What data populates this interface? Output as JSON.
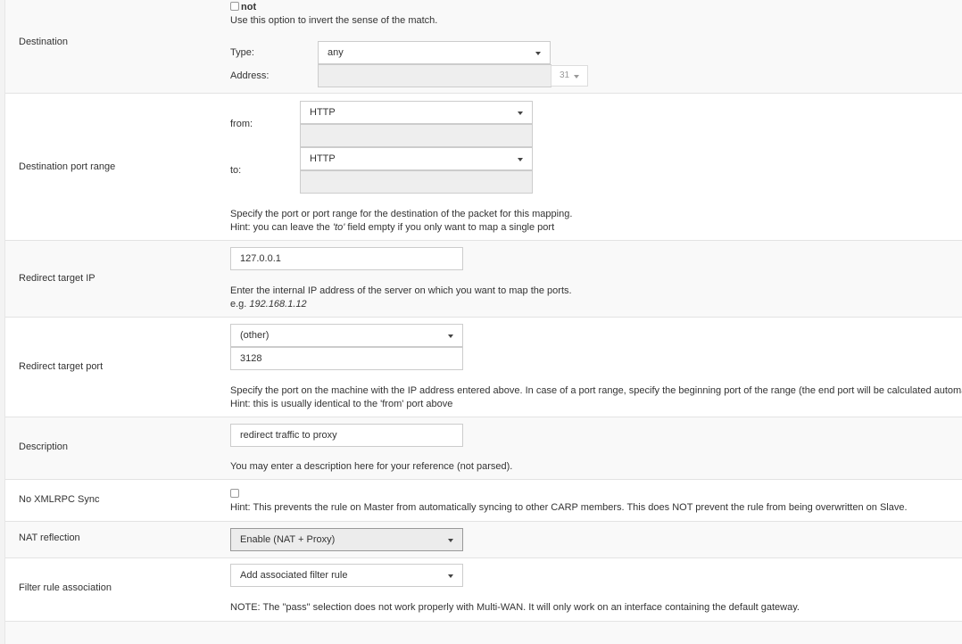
{
  "destination": {
    "label": "Destination",
    "not_label": "not",
    "invert_hint": "Use this option to invert the sense of the match.",
    "type_label": "Type:",
    "type_value": "any",
    "address_label": "Address:",
    "address_value": "",
    "mask_value": "31"
  },
  "dest_port": {
    "label": "Destination port range",
    "from_label": "from:",
    "from_value": "HTTP",
    "from_custom": "",
    "to_label": "to:",
    "to_value": "HTTP",
    "to_custom": "",
    "hint1": "Specify the port or port range for the destination of the packet for this mapping.",
    "hint2_prefix": "Hint: you can leave the ",
    "hint2_em": "'to'",
    "hint2_suffix": " field empty if you only want to map a single port"
  },
  "redirect_ip": {
    "label": "Redirect target IP",
    "value": "127.0.0.1",
    "hint": "Enter the internal IP address of the server on which you want to map the ports.",
    "example_prefix": "e.g. ",
    "example_value": "192.168.1.12"
  },
  "redirect_port": {
    "label": "Redirect target port",
    "select_value": "(other)",
    "value": "3128",
    "hint1": "Specify the port on the machine with the IP address entered above. In case of a port range, specify the beginning port of the range (the end port will be calculated automatically).",
    "hint2": "Hint: this is usually identical to the 'from' port above"
  },
  "description": {
    "label": "Description",
    "value": "redirect traffic to proxy",
    "hint": "You may enter a description here for your reference (not parsed)."
  },
  "xmlrpc": {
    "label": "No XMLRPC Sync",
    "hint": "Hint: This prevents the rule on Master from automatically syncing to other CARP members. This does NOT prevent the rule from being overwritten on Slave."
  },
  "nat_reflection": {
    "label": "NAT reflection",
    "value": "Enable (NAT + Proxy)"
  },
  "filter_rule": {
    "label": "Filter rule association",
    "value": "Add associated filter rule",
    "note": "NOTE: The \"pass\" selection does not work properly with Multi-WAN. It will only work on an interface containing the default gateway."
  }
}
